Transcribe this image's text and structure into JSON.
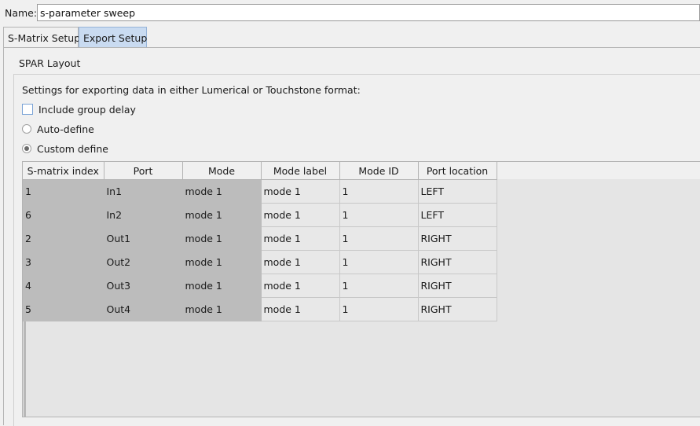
{
  "name_field": {
    "label": "Name:",
    "value": "s-parameter sweep"
  },
  "tabs": [
    {
      "label": "S-Matrix Setup",
      "active": false
    },
    {
      "label": "Export Setup",
      "active": true
    }
  ],
  "section": {
    "title": "SPAR Layout",
    "description": "Settings for exporting data in either Lumerical or Touchstone format:"
  },
  "options": {
    "include_group_delay": {
      "label": "Include group delay",
      "checked": false
    },
    "auto_define": {
      "label": "Auto-define",
      "selected": false
    },
    "custom_define": {
      "label": "Custom define",
      "selected": true
    }
  },
  "table": {
    "columns": [
      "S-matrix index",
      "Port",
      "Mode",
      "Mode label",
      "Mode ID",
      "Port location"
    ],
    "rows": [
      [
        "1",
        "In1",
        "mode 1",
        "mode 1",
        "1",
        "LEFT"
      ],
      [
        "6",
        "In2",
        "mode 1",
        "mode 1",
        "1",
        "LEFT"
      ],
      [
        "2",
        "Out1",
        "mode 1",
        "mode 1",
        "1",
        "RIGHT"
      ],
      [
        "3",
        "Out2",
        "mode 1",
        "mode 1",
        "1",
        "RIGHT"
      ],
      [
        "4",
        "Out3",
        "mode 1",
        "mode 1",
        "1",
        "RIGHT"
      ],
      [
        "5",
        "Out4",
        "mode 1",
        "mode 1",
        "1",
        "RIGHT"
      ]
    ]
  },
  "colors": {
    "active_tab": "#c9dbf1",
    "readonly_cell": "#bcbcbc",
    "editable_cell": "#e8e8e8",
    "checkbox_border": "#7aa3d6"
  }
}
